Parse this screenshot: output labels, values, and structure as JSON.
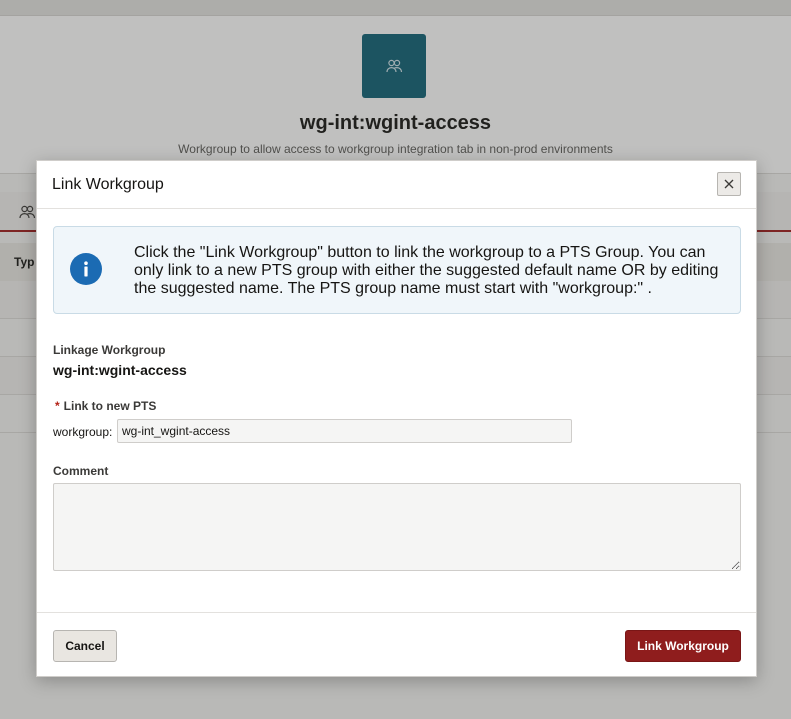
{
  "background": {
    "title": "wg-int:wgint-access",
    "description": "Workgroup to allow access to workgroup integration tab in non-prod environments",
    "table_header_fragment": "Typ",
    "logo_icon": "users-icon",
    "tab_icon": "users-icon"
  },
  "dialog": {
    "title": "Link Workgroup",
    "close_icon": "close-icon",
    "info": {
      "icon": "info-icon",
      "text": "Click the \"Link Workgroup\" button to link the workgroup to a PTS Group. You can only link to a new PTS group with either the suggested default name OR by editing the suggested name. The PTS group name must start with \"workgroup:\" ."
    },
    "linkage_label": "Linkage Workgroup",
    "linkage_value": "wg-int:wgint-access",
    "required_marker": "*",
    "pts_label": "Link to new PTS",
    "pts_prefix": "workgroup:",
    "pts_value": "wg-int_wgint-access",
    "comment_label": "Comment",
    "comment_value": "",
    "cancel_label": "Cancel",
    "link_label": "Link Workgroup"
  },
  "colors": {
    "brand_teal": "#0e6075",
    "primary_button": "#8f1d1d",
    "info_blue": "#1b6bb3"
  }
}
